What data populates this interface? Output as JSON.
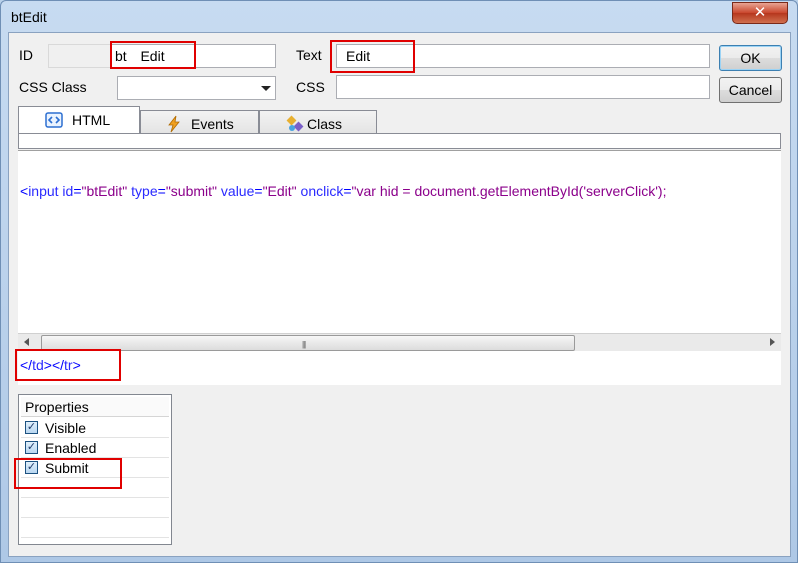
{
  "window": {
    "title": "btEdit",
    "close_glyph": "✕"
  },
  "form": {
    "id_label": "ID",
    "id_prefix": "",
    "id_fixed": "bt",
    "id_value": "Edit",
    "text_label": "Text",
    "text_value": "Edit",
    "css_class_label": "CSS Class",
    "css_class_value": "",
    "css_label": "CSS",
    "css_value": ""
  },
  "buttons": {
    "ok": "OK",
    "cancel": "Cancel"
  },
  "tabs": [
    {
      "label": "HTML",
      "icon": "html-code-icon",
      "active": true
    },
    {
      "label": "Events",
      "icon": "lightning-icon",
      "active": false
    },
    {
      "label": "Class",
      "icon": "class-icon",
      "active": false
    }
  ],
  "editor": {
    "code": [
      {
        "t": "<",
        "c": "c-br"
      },
      {
        "t": "input",
        "c": "c-attr"
      },
      {
        "t": " id",
        "c": "c-attr"
      },
      {
        "t": "=",
        "c": "c-br"
      },
      {
        "t": "\"btEdit\"",
        "c": "c-val"
      },
      {
        "t": " type",
        "c": "c-attr"
      },
      {
        "t": "=",
        "c": "c-br"
      },
      {
        "t": "\"submit\"",
        "c": "c-val"
      },
      {
        "t": " value",
        "c": "c-attr"
      },
      {
        "t": "=",
        "c": "c-br"
      },
      {
        "t": "\"Edit\"",
        "c": "c-val"
      },
      {
        "t": " onclick",
        "c": "c-attr"
      },
      {
        "t": "=",
        "c": "c-br"
      },
      {
        "t": "\"var hid = document.getElementById('serverClick');",
        "c": "c-val"
      }
    ],
    "scroll_grip": "|||",
    "bottom_code": [
      {
        "t": "</",
        "c": "c-br"
      },
      {
        "t": "td",
        "c": "c-attr"
      },
      {
        "t": "></",
        "c": "c-br"
      },
      {
        "t": "tr",
        "c": "c-attr"
      },
      {
        "t": ">",
        "c": "c-br"
      }
    ]
  },
  "properties": {
    "header": "Properties",
    "items": [
      {
        "label": "Visible",
        "checked": true
      },
      {
        "label": "Enabled",
        "checked": true
      },
      {
        "label": "Submit",
        "checked": true
      }
    ],
    "check_glyph": "✓"
  },
  "colors": {
    "highlight": "#e00000"
  }
}
